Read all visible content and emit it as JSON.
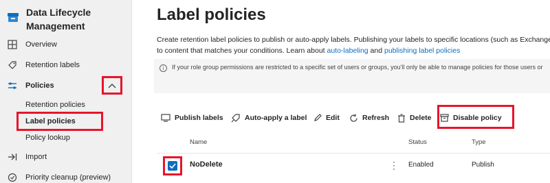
{
  "app": {
    "title": "Data Lifecycle Management"
  },
  "sidebar": {
    "items": [
      {
        "label": "Overview",
        "icon": "overview-icon"
      },
      {
        "label": "Retention labels",
        "icon": "tag-icon"
      },
      {
        "label": "Policies",
        "icon": "sliders-icon"
      },
      {
        "label": "Retention policies"
      },
      {
        "label": "Label policies"
      },
      {
        "label": "Policy lookup"
      },
      {
        "label": "Import",
        "icon": "import-icon"
      },
      {
        "label": "Priority cleanup (preview)",
        "icon": "cleanup-icon"
      }
    ]
  },
  "main": {
    "title": "Label policies",
    "description": {
      "line1": "Create retention label policies to publish or auto-apply labels. Publishing your labels to specific locations (such as Exchange",
      "line2_prefix": "to content that matches your conditions. Learn about ",
      "link1": "auto-labeling",
      "line2_mid": " and ",
      "link2": "publishing label policies"
    },
    "info": "If your role group permissions are restricted to a specific set of users or groups, you'll only be able to manage policies for those users or",
    "toolbar": {
      "publish": "Publish labels",
      "auto_apply": "Auto-apply a label",
      "edit": "Edit",
      "refresh": "Refresh",
      "delete": "Delete",
      "disable": "Disable policy"
    },
    "table": {
      "columns": [
        "Name",
        "Status",
        "Type"
      ],
      "rows": [
        {
          "name": "NoDelete",
          "status": "Enabled",
          "type": "Publish",
          "selected": true
        }
      ]
    }
  },
  "colors": {
    "accent": "#0f6cbd",
    "highlight": "#e8132a",
    "sidebar_bg": "#f0f0f0"
  }
}
